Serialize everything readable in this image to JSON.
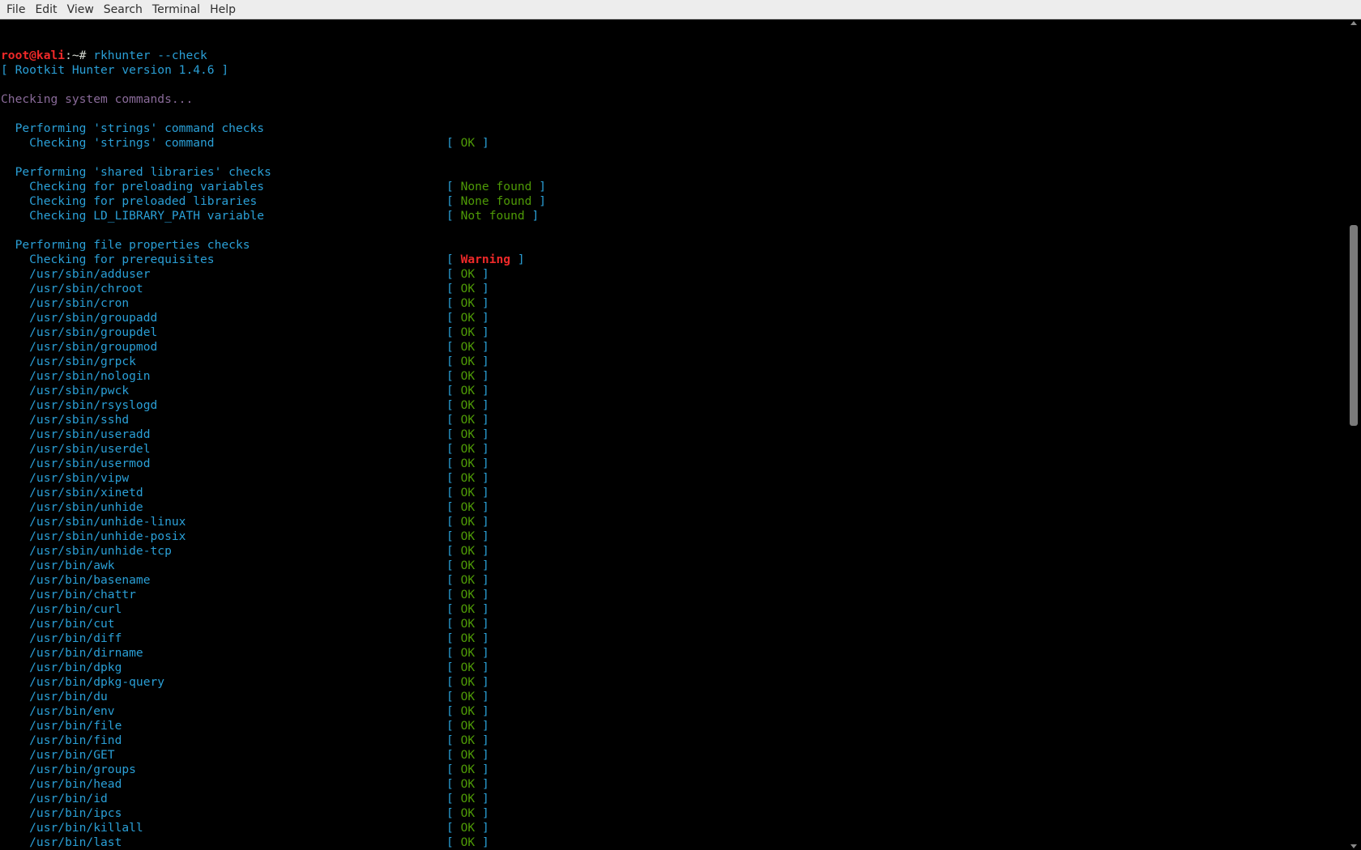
{
  "menu": [
    "File",
    "Edit",
    "View",
    "Search",
    "Terminal",
    "Help"
  ],
  "prompt": {
    "user_host": "root@kali",
    "sep": ":~# ",
    "command": "rkhunter --check"
  },
  "version_line": "[ Rootkit Hunter version 1.4.6 ]",
  "checking_line": "Checking system commands...",
  "sections": [
    {
      "title": "  Performing 'strings' command checks",
      "rows": [
        {
          "label": "    Checking 'strings' command",
          "status": "OK"
        }
      ]
    },
    {
      "title": "  Performing 'shared libraries' checks",
      "rows": [
        {
          "label": "    Checking for preloading variables",
          "status": "None found"
        },
        {
          "label": "    Checking for preloaded libraries",
          "status": "None found"
        },
        {
          "label": "    Checking LD_LIBRARY_PATH variable",
          "status": "Not found"
        }
      ]
    },
    {
      "title": "  Performing file properties checks",
      "rows": [
        {
          "label": "    Checking for prerequisites",
          "status": "Warning"
        },
        {
          "label": "    /usr/sbin/adduser",
          "status": "OK"
        },
        {
          "label": "    /usr/sbin/chroot",
          "status": "OK"
        },
        {
          "label": "    /usr/sbin/cron",
          "status": "OK"
        },
        {
          "label": "    /usr/sbin/groupadd",
          "status": "OK"
        },
        {
          "label": "    /usr/sbin/groupdel",
          "status": "OK"
        },
        {
          "label": "    /usr/sbin/groupmod",
          "status": "OK"
        },
        {
          "label": "    /usr/sbin/grpck",
          "status": "OK"
        },
        {
          "label": "    /usr/sbin/nologin",
          "status": "OK"
        },
        {
          "label": "    /usr/sbin/pwck",
          "status": "OK"
        },
        {
          "label": "    /usr/sbin/rsyslogd",
          "status": "OK"
        },
        {
          "label": "    /usr/sbin/sshd",
          "status": "OK"
        },
        {
          "label": "    /usr/sbin/useradd",
          "status": "OK"
        },
        {
          "label": "    /usr/sbin/userdel",
          "status": "OK"
        },
        {
          "label": "    /usr/sbin/usermod",
          "status": "OK"
        },
        {
          "label": "    /usr/sbin/vipw",
          "status": "OK"
        },
        {
          "label": "    /usr/sbin/xinetd",
          "status": "OK"
        },
        {
          "label": "    /usr/sbin/unhide",
          "status": "OK"
        },
        {
          "label": "    /usr/sbin/unhide-linux",
          "status": "OK"
        },
        {
          "label": "    /usr/sbin/unhide-posix",
          "status": "OK"
        },
        {
          "label": "    /usr/sbin/unhide-tcp",
          "status": "OK"
        },
        {
          "label": "    /usr/bin/awk",
          "status": "OK"
        },
        {
          "label": "    /usr/bin/basename",
          "status": "OK"
        },
        {
          "label": "    /usr/bin/chattr",
          "status": "OK"
        },
        {
          "label": "    /usr/bin/curl",
          "status": "OK"
        },
        {
          "label": "    /usr/bin/cut",
          "status": "OK"
        },
        {
          "label": "    /usr/bin/diff",
          "status": "OK"
        },
        {
          "label": "    /usr/bin/dirname",
          "status": "OK"
        },
        {
          "label": "    /usr/bin/dpkg",
          "status": "OK"
        },
        {
          "label": "    /usr/bin/dpkg-query",
          "status": "OK"
        },
        {
          "label": "    /usr/bin/du",
          "status": "OK"
        },
        {
          "label": "    /usr/bin/env",
          "status": "OK"
        },
        {
          "label": "    /usr/bin/file",
          "status": "OK"
        },
        {
          "label": "    /usr/bin/find",
          "status": "OK"
        },
        {
          "label": "    /usr/bin/GET",
          "status": "OK"
        },
        {
          "label": "    /usr/bin/groups",
          "status": "OK"
        },
        {
          "label": "    /usr/bin/head",
          "status": "OK"
        },
        {
          "label": "    /usr/bin/id",
          "status": "OK"
        },
        {
          "label": "    /usr/bin/ipcs",
          "status": "OK"
        },
        {
          "label": "    /usr/bin/killall",
          "status": "OK"
        },
        {
          "label": "    /usr/bin/last",
          "status": "OK"
        }
      ]
    }
  ],
  "colors": {
    "text": "#2a9fd6",
    "prompt_user": "#ef2929",
    "status_ok": "#4e9a06",
    "status_warning": "#ef2929",
    "muted": "#8a6b9a"
  }
}
